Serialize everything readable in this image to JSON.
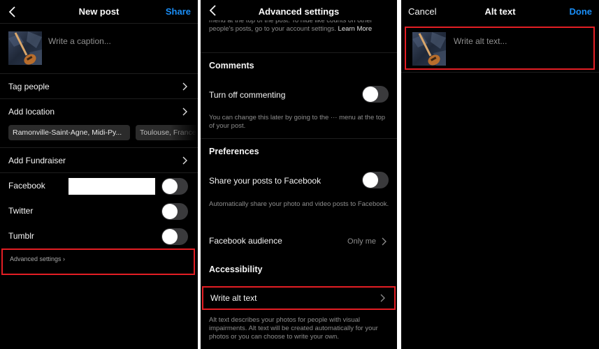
{
  "new_post": {
    "title": "New post",
    "share_label": "Share",
    "caption_placeholder": "Write a caption...",
    "tag_people_label": "Tag people",
    "add_location_label": "Add location",
    "location_suggestions": [
      "Ramonville-Saint-Agne, Midi-Py...",
      "Toulouse, France"
    ],
    "add_fundraiser_label": "Add Fundraiser",
    "share_targets": [
      {
        "label": "Facebook",
        "enabled": false
      },
      {
        "label": "Twitter",
        "enabled": false
      },
      {
        "label": "Tumblr",
        "enabled": false
      }
    ],
    "advanced_settings_label": "Advanced settings"
  },
  "advanced_settings": {
    "title": "Advanced settings",
    "top_note": "menu at the top of the post. To hide like counts on other people's posts, go to your account settings.",
    "learn_more": "Learn More",
    "comments_heading": "Comments",
    "turn_off_commenting_label": "Turn off commenting",
    "turn_off_commenting_enabled": false,
    "commenting_note": "You can change this later by going to the ··· menu at the top of your post.",
    "preferences_heading": "Preferences",
    "share_to_facebook_label": "Share your posts to Facebook",
    "share_to_facebook_enabled": false,
    "share_to_facebook_note": "Automatically share your photo and video posts to Facebook.",
    "facebook_audience_label": "Facebook audience",
    "facebook_audience_value": "Only me",
    "accessibility_heading": "Accessibility",
    "write_alt_text_label": "Write alt text",
    "alt_text_note": "Alt text describes your photos for people with visual impairments. Alt text will be created automatically for your photos or you can choose to write your own."
  },
  "alt_text": {
    "title": "Alt text",
    "cancel_label": "Cancel",
    "done_label": "Done",
    "input_placeholder": "Write alt text..."
  },
  "colors": {
    "accent_blue": "#1a8ef7",
    "highlight_red": "#e31e24",
    "background": "#000000"
  }
}
